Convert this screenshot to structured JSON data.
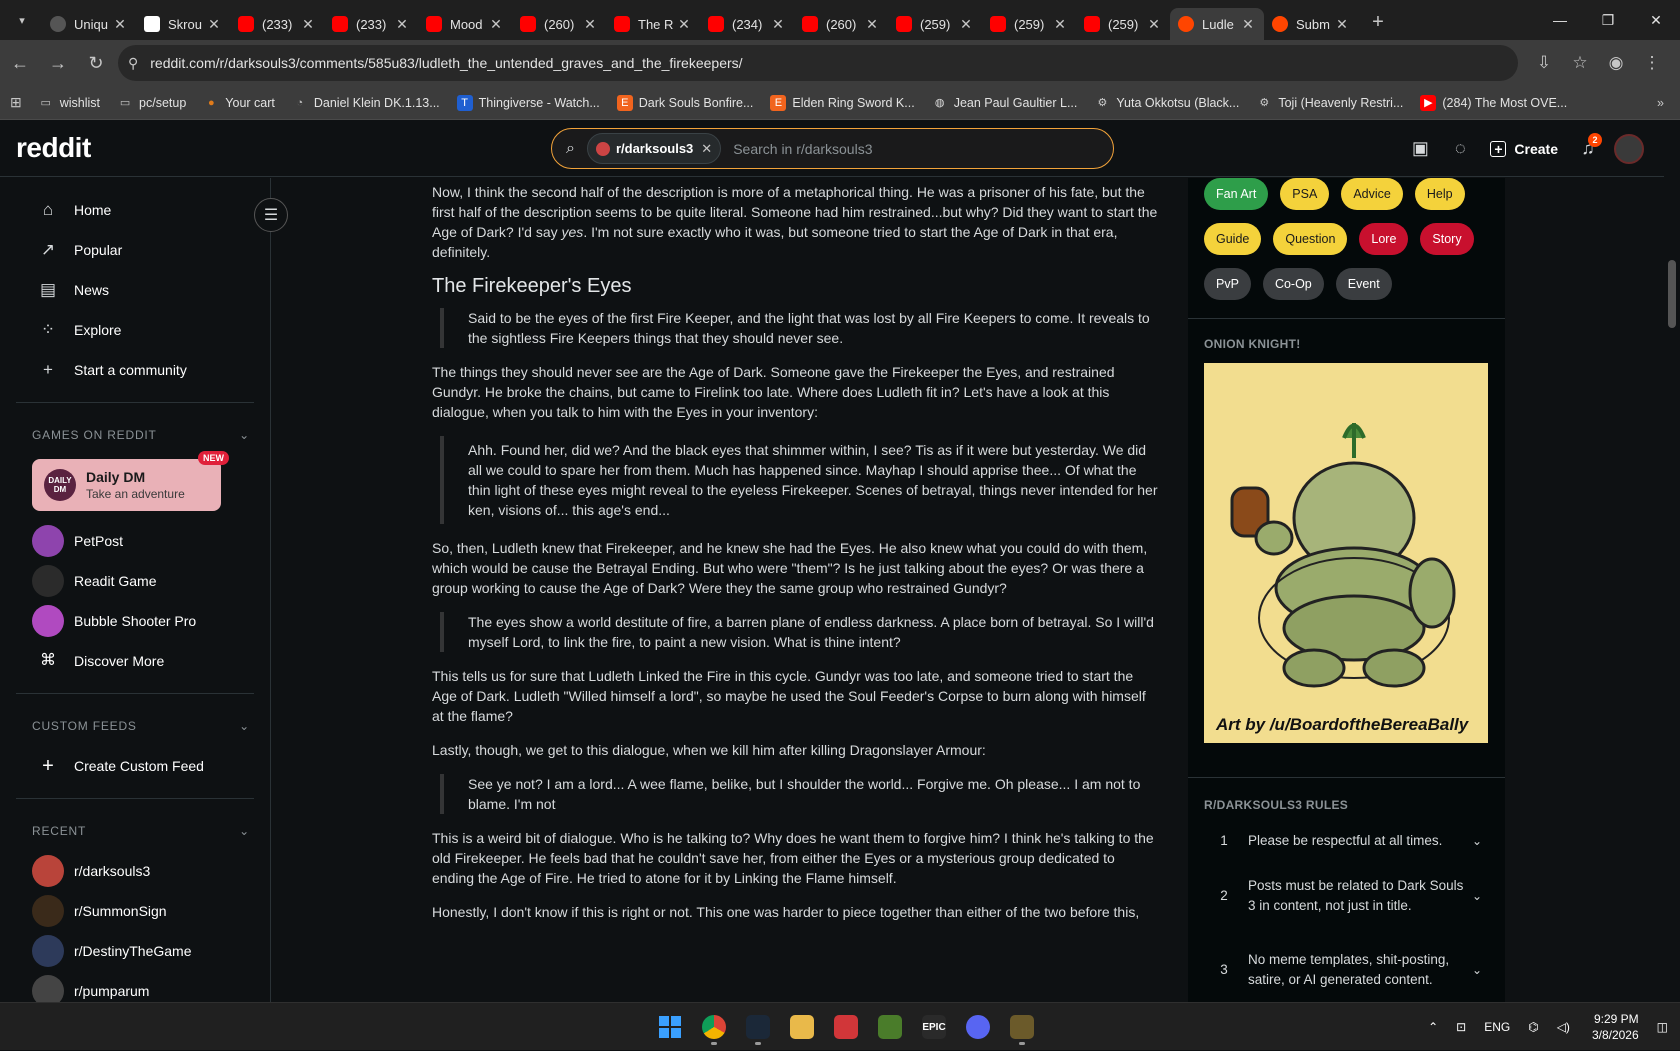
{
  "browser": {
    "tabs": [
      {
        "title": "Uniqu",
        "favicon": "ms"
      },
      {
        "title": "Skrou",
        "favicon": "st"
      },
      {
        "title": "(233)",
        "favicon": "yt"
      },
      {
        "title": "(233)",
        "favicon": "yt"
      },
      {
        "title": "Mood",
        "favicon": "yt"
      },
      {
        "title": "(260)",
        "favicon": "yt"
      },
      {
        "title": "The R",
        "favicon": "yt"
      },
      {
        "title": "(234)",
        "favicon": "yt"
      },
      {
        "title": "(260)",
        "favicon": "yt"
      },
      {
        "title": "(259)",
        "favicon": "yt"
      },
      {
        "title": "(259)",
        "favicon": "yt"
      },
      {
        "title": "(259)",
        "favicon": "yt"
      },
      {
        "title": "Ludle",
        "favicon": "rd",
        "active": true
      },
      {
        "title": "Subm",
        "favicon": "rd"
      }
    ],
    "url": "reddit.com/r/darksouls3/comments/585u83/ludleth_the_untended_graves_and_the_firekeepers/",
    "bookmarks": [
      {
        "label": "wishlist",
        "icon": "folder-icon"
      },
      {
        "label": "pc/setup",
        "icon": "folder-icon"
      },
      {
        "label": "Your cart",
        "icon": "cart-icon"
      },
      {
        "label": "Daniel Klein DK.1.13...",
        "icon": "watch-icon"
      },
      {
        "label": "Thingiverse - Watch...",
        "icon": "thingiverse-icon"
      },
      {
        "label": "Dark Souls Bonfire...",
        "icon": "etsy-icon"
      },
      {
        "label": "Elden Ring Sword K...",
        "icon": "etsy-icon"
      },
      {
        "label": "Jean Paul Gaultier L...",
        "icon": "globe-icon"
      },
      {
        "label": "Yuta Okkotsu (Black...",
        "icon": "car-icon"
      },
      {
        "label": "Toji (Heavenly Restri...",
        "icon": "car-icon"
      },
      {
        "label": "(284) The Most OVE...",
        "icon": "youtube-icon"
      }
    ]
  },
  "header": {
    "logo": "reddit",
    "search_chip": "r/darksouls3",
    "search_placeholder": "Search in r/darksouls3",
    "create_label": "Create",
    "notif_count": "2"
  },
  "sidebar": {
    "nav": [
      {
        "label": "Home",
        "icon": "home-icon",
        "glyph": "⌂"
      },
      {
        "label": "Popular",
        "icon": "popular-icon",
        "glyph": "↗"
      },
      {
        "label": "News",
        "icon": "news-icon",
        "glyph": "▤"
      },
      {
        "label": "Explore",
        "icon": "explore-icon",
        "glyph": "⁘"
      },
      {
        "label": "Start a community",
        "icon": "plus-icon",
        "glyph": "+"
      }
    ],
    "games_header": "GAMES ON REDDIT",
    "daily_dm": {
      "title": "Daily DM",
      "subtitle": "Take an adventure",
      "badge": "NEW",
      "icon_text": "DAILY DM"
    },
    "games": [
      {
        "label": "PetPost",
        "color": "#8e44ad"
      },
      {
        "label": "Readit Game",
        "color": "#2b2b2b"
      },
      {
        "label": "Bubble Shooter Pro",
        "color": "#b04ac0"
      },
      {
        "label": "Discover More",
        "color": "none"
      }
    ],
    "custom_feeds_header": "CUSTOM FEEDS",
    "create_custom_feed": "Create Custom Feed",
    "recent_header": "RECENT",
    "recent": [
      {
        "label": "r/darksouls3",
        "color": "#b9443a"
      },
      {
        "label": "r/SummonSign",
        "color": "#3a2a1a"
      },
      {
        "label": "r/DestinyTheGame",
        "color": "#2d3a5a"
      },
      {
        "label": "r/pumparum",
        "color": "#444"
      }
    ]
  },
  "post": {
    "p1": "Now, I think the second half of the description is more of a metaphorical thing. He was a prisoner of his fate, but the first half of the description seems to be quite literal. Someone had him restrained...but why? Did they want to start the Age of Dark? I'd say ",
    "p1_em": "yes",
    "p1_end": ". I'm not sure exactly who it was, but someone tried to start the Age of Dark in that era, definitely.",
    "h_eyes": "The Firekeeper's Eyes",
    "q1": "Said to be the eyes of the first Fire Keeper, and the light that was lost by all Fire Keepers to come. It reveals to the sightless Fire Keepers things that they should never see.",
    "p2": "The things they should never see are the Age of Dark. Someone gave the Firekeeper the Eyes, and restrained Gundyr. He broke the chains, but came to Firelink too late. Where does Ludleth fit in? Let's have a look at this dialogue, when you talk to him with the Eyes in your inventory:",
    "q2": "Ahh. Found her, did we? And the black eyes that shimmer within, I see? Tis as if it were but yesterday. We did all we could to spare her from them. Much has happened since. Mayhap I should apprise thee... Of what the thin light of these eyes might reveal to the eyeless Firekeeper. Scenes of betrayal, things never intended for her ken, visions of... this age's end...",
    "p3": "So, then, Ludleth knew that Firekeeper, and he knew she had the Eyes. He also knew what you could do with them, which would be cause the Betrayal Ending. But who were \"them\"? Is he just talking about the eyes? Or was there a group working to cause the Age of Dark? Were they the same group who restrained Gundyr?",
    "q3": "The eyes show a world destitute of fire, a barren plane of endless darkness. A place born of betrayal. So I will'd myself Lord, to link the fire, to paint a new vision. What is thine intent?",
    "p4": "This tells us for sure that Ludleth Linked the Fire in this cycle. Gundyr was too late, and someone tried to start the Age of Dark. Ludleth \"Willed himself a lord\", so maybe he used the Soul Feeder's Corpse to burn along with himself at the flame?",
    "p5": "Lastly, though, we get to this dialogue, when we kill him after killing Dragonslayer Armour:",
    "q4": "See ye not? I am a lord... A wee flame, belike, but I shoulder the world... Forgive me. Oh please... I am not to blame. I'm not",
    "p6": "This is a weird bit of dialogue. Who is he talking to? Why does he want them to forgive him? I think he's talking to the old Firekeeper. He feels bad that he couldn't save her, from either the Eyes or a mysterious group dedicated to ending the Age of Fire. He tried to atone for it by Linking the Flame himself.",
    "p7": "Honestly, I don't know if this is right or not. This one was harder to piece together than either of the two before this,"
  },
  "right": {
    "flairs": [
      {
        "label": "Fan Art",
        "bg": "#2e9e4a",
        "fg": "#ffffff"
      },
      {
        "label": "PSA",
        "bg": "#f4d23b",
        "fg": "#1a1a1b"
      },
      {
        "label": "Advice",
        "bg": "#f4d23b",
        "fg": "#1a1a1b"
      },
      {
        "label": "Help",
        "bg": "#f4d23b",
        "fg": "#1a1a1b"
      },
      {
        "label": "Guide",
        "bg": "#f4d23b",
        "fg": "#1a1a1b"
      },
      {
        "label": "Question",
        "bg": "#f4d23b",
        "fg": "#1a1a1b"
      },
      {
        "label": "Lore",
        "bg": "#c8102e",
        "fg": "#ffffff"
      },
      {
        "label": "Story",
        "bg": "#c8102e",
        "fg": "#ffffff"
      },
      {
        "label": "PvP",
        "bg": "#3a3d40",
        "fg": "#ffffff"
      },
      {
        "label": "Co-Op",
        "bg": "#3a3d40",
        "fg": "#ffffff"
      },
      {
        "label": "Event",
        "bg": "#3a3d40",
        "fg": "#ffffff"
      }
    ],
    "onion_title": "ONION KNIGHT!",
    "onion_caption": "Art by /u/BoardoftheBereaBally",
    "rules_title": "R/DARKSOULS3 RULES",
    "rules": [
      {
        "n": "1",
        "text": "Please be respectful at all times."
      },
      {
        "n": "2",
        "text": "Posts must be related to Dark Souls 3 in content, not just in title."
      },
      {
        "n": "3",
        "text": "No meme templates, shit-posting, satire, or AI generated content."
      }
    ]
  },
  "taskbar": {
    "apps": [
      {
        "name": "windows-start-icon",
        "color": "#1e90ff",
        "text": "",
        "active": false
      },
      {
        "name": "chrome-icon",
        "color": "#e8a33d",
        "text": "",
        "active": true
      },
      {
        "name": "steam-icon",
        "color": "#1b2838",
        "text": "",
        "active": true
      },
      {
        "name": "goose-icon",
        "color": "#e9b94a",
        "text": "",
        "active": false
      },
      {
        "name": "riot-icon",
        "color": "#d13639",
        "text": "",
        "active": false
      },
      {
        "name": "minecraft-icon",
        "color": "#4a7c2a",
        "text": "",
        "active": false
      },
      {
        "name": "epic-games-icon",
        "color": "#2a2a2a",
        "text": "EPIC",
        "active": false
      },
      {
        "name": "discord-icon",
        "color": "#5865f2",
        "text": "",
        "active": false
      },
      {
        "name": "dark-souls-icon",
        "color": "#6b5a2a",
        "text": "",
        "active": true
      }
    ],
    "lang": "ENG",
    "time": "9:29 PM",
    "date": "3/8/2026"
  }
}
